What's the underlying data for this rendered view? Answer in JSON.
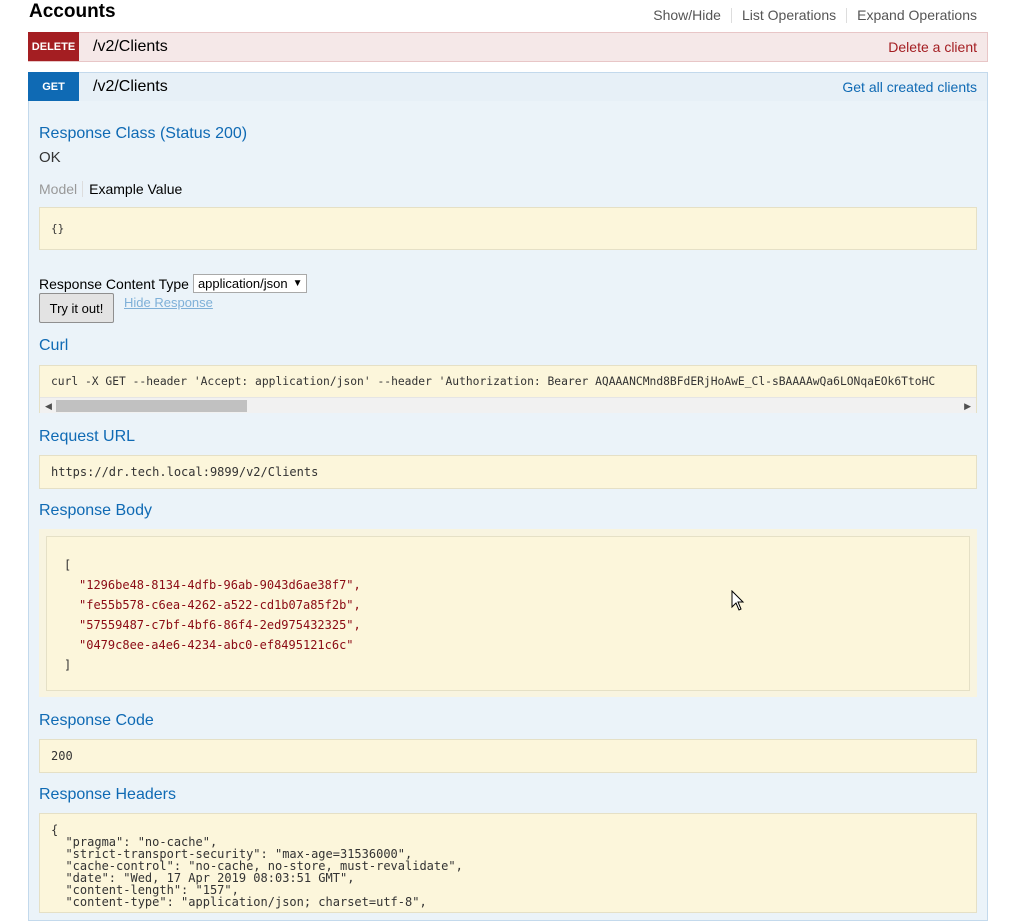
{
  "page": {
    "title": "Accounts"
  },
  "nav": {
    "show_hide": "Show/Hide",
    "list_operations": "List Operations",
    "expand_operations": "Expand Operations"
  },
  "operations": {
    "delete": {
      "method": "DELETE",
      "path": "/v2/Clients",
      "summary": "Delete a client"
    },
    "get": {
      "method": "GET",
      "path": "/v2/Clients",
      "summary": "Get all created clients"
    }
  },
  "response_class": {
    "heading": "Response Class (Status 200)",
    "value": "OK",
    "tab_model": "Model",
    "tab_example": "Example Value",
    "example": "{}"
  },
  "content_type": {
    "label": "Response Content Type",
    "selected": "application/json"
  },
  "actions": {
    "try_it_out": "Try it out!",
    "hide_response": "Hide Response"
  },
  "curl": {
    "heading": "Curl",
    "command": "curl -X GET --header 'Accept: application/json' --header 'Authorization: Bearer AQAAANCMnd8BFdERjHoAwE_Cl-sBAAAAwQa6LONqaEOk6TtoHC"
  },
  "request_url": {
    "heading": "Request URL",
    "value": "https://dr.tech.local:9899/v2/Clients"
  },
  "response_body": {
    "heading": "Response Body",
    "open": "[",
    "items": [
      "\"1296be48-8134-4dfb-96ab-9043d6ae38f7\",",
      "\"fe55b578-c6ea-4262-a522-cd1b07a85f2b\",",
      "\"57559487-c7bf-4bf6-86f4-2ed975432325\",",
      "\"0479c8ee-a4e6-4234-abc0-ef8495121c6c\""
    ],
    "close": "]"
  },
  "response_code": {
    "heading": "Response Code",
    "value": "200"
  },
  "response_headers": {
    "heading": "Response Headers",
    "lines": [
      "{",
      "  \"pragma\": \"no-cache\",",
      "  \"strict-transport-security\": \"max-age=31536000\",",
      "  \"cache-control\": \"no-cache, no-store, must-revalidate\",",
      "  \"date\": \"Wed, 17 Apr 2019 08:03:51 GMT\",",
      "  \"content-length\": \"157\",",
      "  \"content-type\": \"application/json; charset=utf-8\","
    ]
  },
  "colors": {
    "delete": "#a41e22",
    "get": "#0f6ab4",
    "panel": "#ebf3f9",
    "code_bg": "#fcf6db"
  }
}
